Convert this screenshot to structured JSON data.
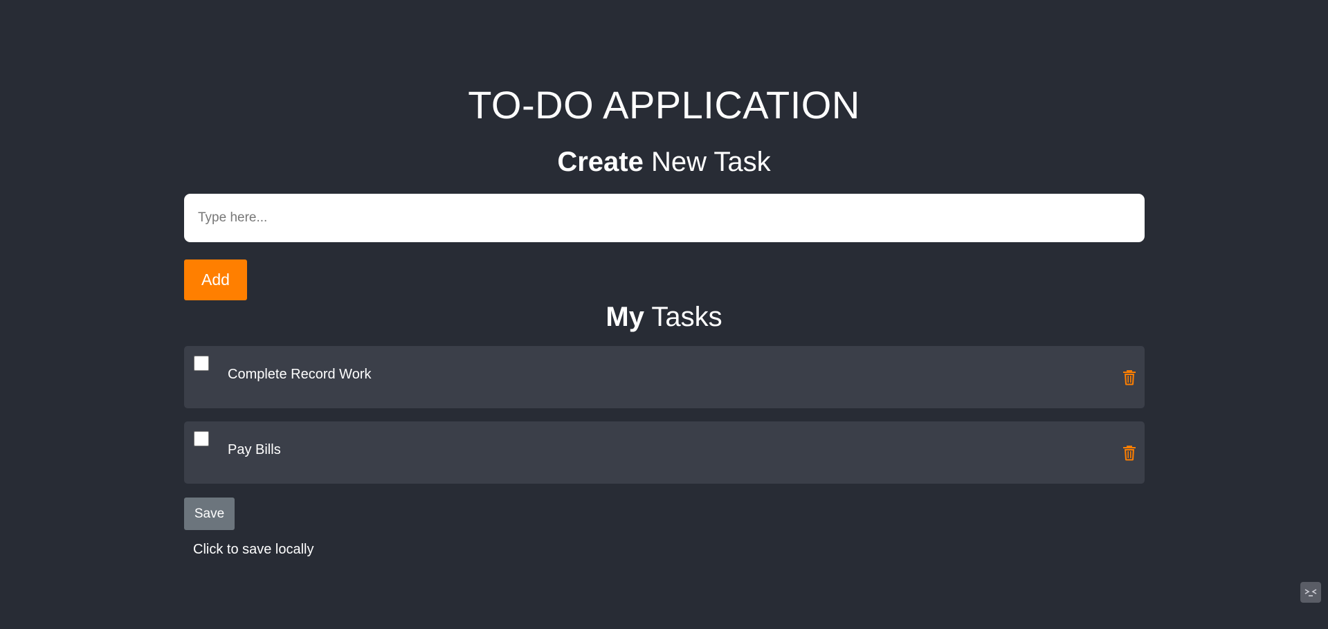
{
  "app": {
    "title": "TO-DO APPLICATION"
  },
  "create_section": {
    "title_bold": "Create",
    "title_rest": " New Task",
    "input_placeholder": "Type here...",
    "input_value": "",
    "add_label": "Add"
  },
  "tasks_section": {
    "title_bold": "My",
    "title_rest": " Tasks",
    "tasks": [
      {
        "text": "Complete Record Work",
        "checked": false,
        "icon": "trash-icon"
      },
      {
        "text": "Pay Bills",
        "checked": false,
        "icon": "trash-icon"
      }
    ]
  },
  "footer": {
    "save_label": "Save",
    "save_hint": "Click to save locally"
  },
  "colors": {
    "background": "#282c35",
    "accent": "#ff7f00",
    "task_bg": "#3b3f49",
    "save_button": "#6c757d"
  }
}
